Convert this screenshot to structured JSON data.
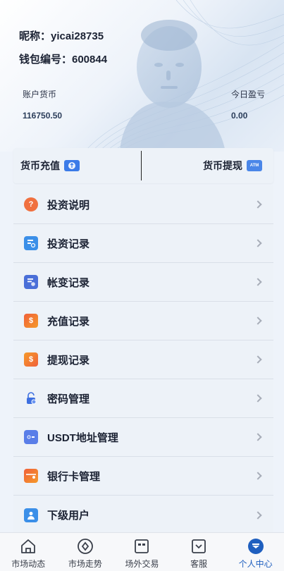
{
  "profile": {
    "nickname": "昵称：yicai28735",
    "wallet": "钱包编号：600844",
    "balance_label": "账户货币",
    "balance_value": "116750.50",
    "pnl_label": "今日盈亏",
    "pnl_value": "0.00"
  },
  "actions": {
    "recharge": "货币充值",
    "withdraw": "货币提现",
    "atm_text": "ATM"
  },
  "menu": [
    {
      "label": "投资说明",
      "icon": "question-icon",
      "color": "#f0703f"
    },
    {
      "label": "投资记录",
      "icon": "search-record-icon",
      "color": "#3b8fe8"
    },
    {
      "label": "帐变记录",
      "icon": "ledger-icon",
      "color": "#4a6fd8"
    },
    {
      "label": "充值记录",
      "icon": "deposit-icon",
      "color": "#f0603a"
    },
    {
      "label": "提现记录",
      "icon": "withdraw-icon",
      "color": "#f59a2a"
    },
    {
      "label": "密码管理",
      "icon": "lock-icon",
      "color": "#3d6fe0"
    },
    {
      "label": "USDT地址管理",
      "icon": "usdt-card-icon",
      "color": "#5a7ee8"
    },
    {
      "label": "银行卡管理",
      "icon": "bank-card-icon",
      "color": "#f0603a"
    },
    {
      "label": "下级用户",
      "icon": "user-icon",
      "color": "#3b8fe8"
    }
  ],
  "tabs": [
    {
      "label": "市场动态",
      "icon": "home-icon"
    },
    {
      "label": "市场走势",
      "icon": "trend-icon"
    },
    {
      "label": "场外交易",
      "icon": "otc-icon"
    },
    {
      "label": "客服",
      "icon": "service-icon"
    },
    {
      "label": "个人中心",
      "icon": "profile-icon",
      "active": true
    }
  ],
  "colors": {
    "accent": "#1f5fbf",
    "menu_bg": "#edf2f8"
  }
}
